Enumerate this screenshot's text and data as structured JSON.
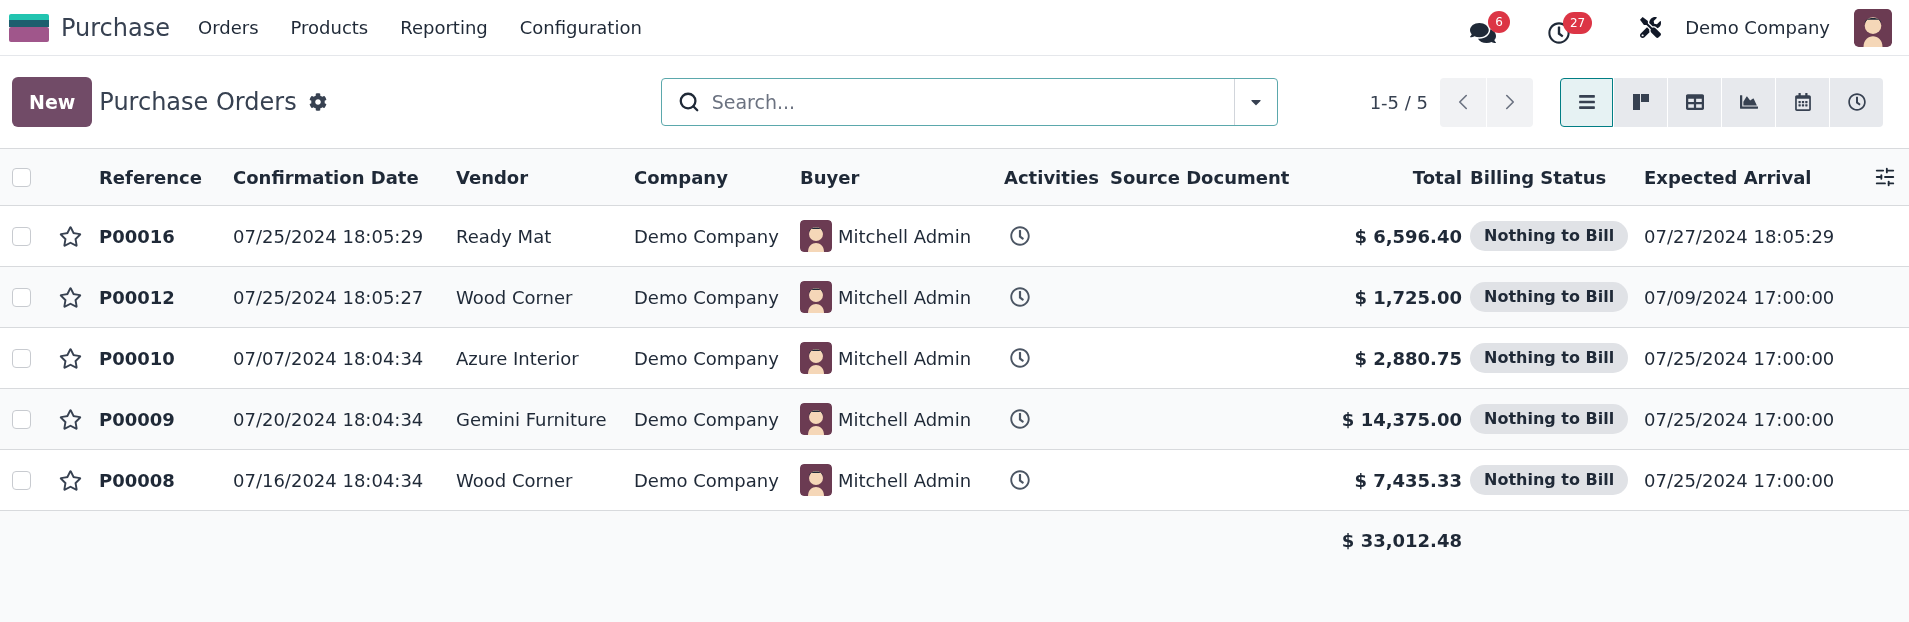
{
  "navbar": {
    "app_name": "Purchase",
    "menu": [
      "Orders",
      "Products",
      "Reporting",
      "Configuration"
    ],
    "messages_count": "6",
    "activities_count": "27",
    "company": "Demo Company"
  },
  "control_panel": {
    "new_button": "New",
    "title": "Purchase Orders",
    "search": {
      "placeholder": "Search..."
    },
    "pager": "1-5 / 5",
    "views": [
      {
        "kind": "list",
        "selected": true
      },
      {
        "kind": "kanban",
        "selected": false
      },
      {
        "kind": "pivot",
        "selected": false
      },
      {
        "kind": "graph",
        "selected": false
      },
      {
        "kind": "calendar",
        "selected": false
      },
      {
        "kind": "activity",
        "selected": false
      }
    ]
  },
  "table": {
    "columns": [
      "Reference",
      "Confirmation Date",
      "Vendor",
      "Company",
      "Buyer",
      "Activities",
      "Source Document",
      "Total",
      "Billing Status",
      "Expected Arrival"
    ],
    "rows": [
      {
        "checked": false,
        "starred": false,
        "reference": "P00016",
        "confirmation_date": "07/25/2024 18:05:29",
        "vendor": "Ready Mat",
        "company": "Demo Company",
        "buyer": "Mitchell Admin",
        "total": "$ 6,596.40",
        "billing_status": "Nothing to Bill",
        "expected_arrival": "07/27/2024 18:05:29"
      },
      {
        "checked": false,
        "starred": false,
        "reference": "P00012",
        "confirmation_date": "07/25/2024 18:05:27",
        "vendor": "Wood Corner",
        "company": "Demo Company",
        "buyer": "Mitchell Admin",
        "total": "$ 1,725.00",
        "billing_status": "Nothing to Bill",
        "expected_arrival": "07/09/2024 17:00:00"
      },
      {
        "checked": false,
        "starred": false,
        "reference": "P00010",
        "confirmation_date": "07/07/2024 18:04:34",
        "vendor": "Azure Interior",
        "company": "Demo Company",
        "buyer": "Mitchell Admin",
        "total": "$ 2,880.75",
        "billing_status": "Nothing to Bill",
        "expected_arrival": "07/25/2024 17:00:00"
      },
      {
        "checked": false,
        "starred": false,
        "reference": "P00009",
        "confirmation_date": "07/20/2024 18:04:34",
        "vendor": "Gemini Furniture",
        "company": "Demo Company",
        "buyer": "Mitchell Admin",
        "total": "$ 14,375.00",
        "billing_status": "Nothing to Bill",
        "expected_arrival": "07/25/2024 17:00:00"
      },
      {
        "checked": false,
        "starred": false,
        "reference": "P00008",
        "confirmation_date": "07/16/2024 18:04:34",
        "vendor": "Wood Corner",
        "company": "Demo Company",
        "buyer": "Mitchell Admin",
        "total": "$ 7,435.33",
        "billing_status": "Nothing to Bill",
        "expected_arrival": "07/25/2024 17:00:00"
      }
    ],
    "header_checked": false,
    "sum_total": "$ 33,012.48"
  }
}
